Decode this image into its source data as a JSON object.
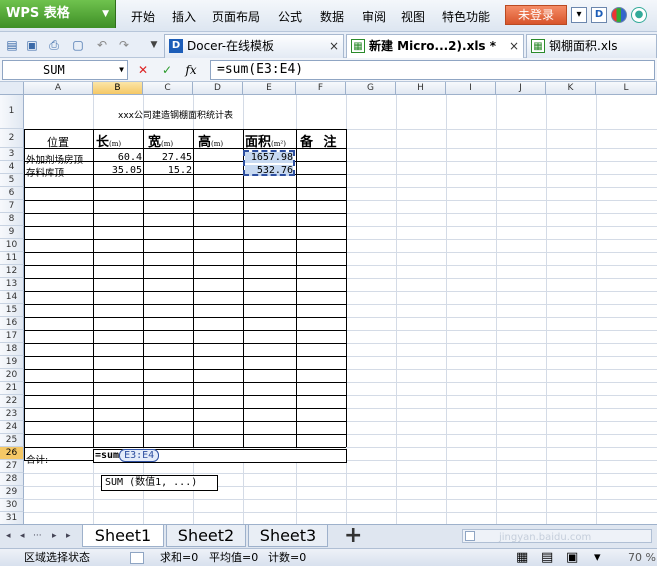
{
  "app": {
    "logo_label": "WPS 表格",
    "menu": [
      "开始",
      "插入",
      "页面布局",
      "公式",
      "数据",
      "审阅",
      "视图",
      "特色功能"
    ],
    "login_label": "未登录"
  },
  "tabs": [
    {
      "label": "Docer-在线模板",
      "close": "×"
    },
    {
      "label": "新建 Micro...2).xls *",
      "close": "×"
    },
    {
      "label": "钢棚面积.xls",
      "close": ""
    }
  ],
  "formula_bar": {
    "name_box": "SUM",
    "cancel": "✕",
    "confirm": "✓",
    "fx": "fx",
    "formula": "=sum(E3:E4)"
  },
  "columns": [
    "A",
    "B",
    "C",
    "D",
    "E",
    "F",
    "G",
    "H",
    "I",
    "J",
    "K",
    "L"
  ],
  "rows": [
    "1",
    "2",
    "3",
    "4",
    "5",
    "6",
    "7",
    "8",
    "9",
    "10",
    "11",
    "12",
    "13",
    "14",
    "15",
    "16",
    "17",
    "18",
    "19",
    "20",
    "21",
    "22",
    "23",
    "24",
    "25",
    "26",
    "27",
    "28",
    "29",
    "30",
    "31"
  ],
  "sheet": {
    "title": "xxx公司建造钢棚面积统计表",
    "headers": {
      "position": "位置",
      "length": "长",
      "length_unit": "(m)",
      "width": "宽",
      "width_unit": "(m)",
      "height": "高",
      "height_unit": "(m)",
      "area": "面积",
      "area_unit": "(m²)",
      "remarks": "备 注"
    },
    "data_rows": [
      {
        "position": "外加剂场房顶",
        "length": "60.4",
        "width": "27.45",
        "height": "",
        "area": "1657.98"
      },
      {
        "position": "存料库顶",
        "length": "35.05",
        "width": "15.2",
        "height": "",
        "area": "532.76"
      }
    ],
    "total_label": "合计:",
    "total_formula_prefix": "=sum",
    "total_formula_ref": "E3:E4",
    "tooltip": "SUM (数值1, ...)"
  },
  "sheet_tabs": [
    "Sheet1",
    "Sheet2",
    "Sheet3"
  ],
  "sheet_nav": [
    "◂",
    "◂",
    "···",
    "▸",
    "▸"
  ],
  "add_sheet": "+",
  "status": {
    "mode": "区域选择状态",
    "sum": "求和=0",
    "avg": "平均值=0",
    "count": "计数=0",
    "zoom": "70 %"
  },
  "watermark": "jingyan.baidu.com",
  "colors": {
    "accent": "#3e8f26",
    "login": "#d8542b",
    "selection": "#f5c866"
  }
}
